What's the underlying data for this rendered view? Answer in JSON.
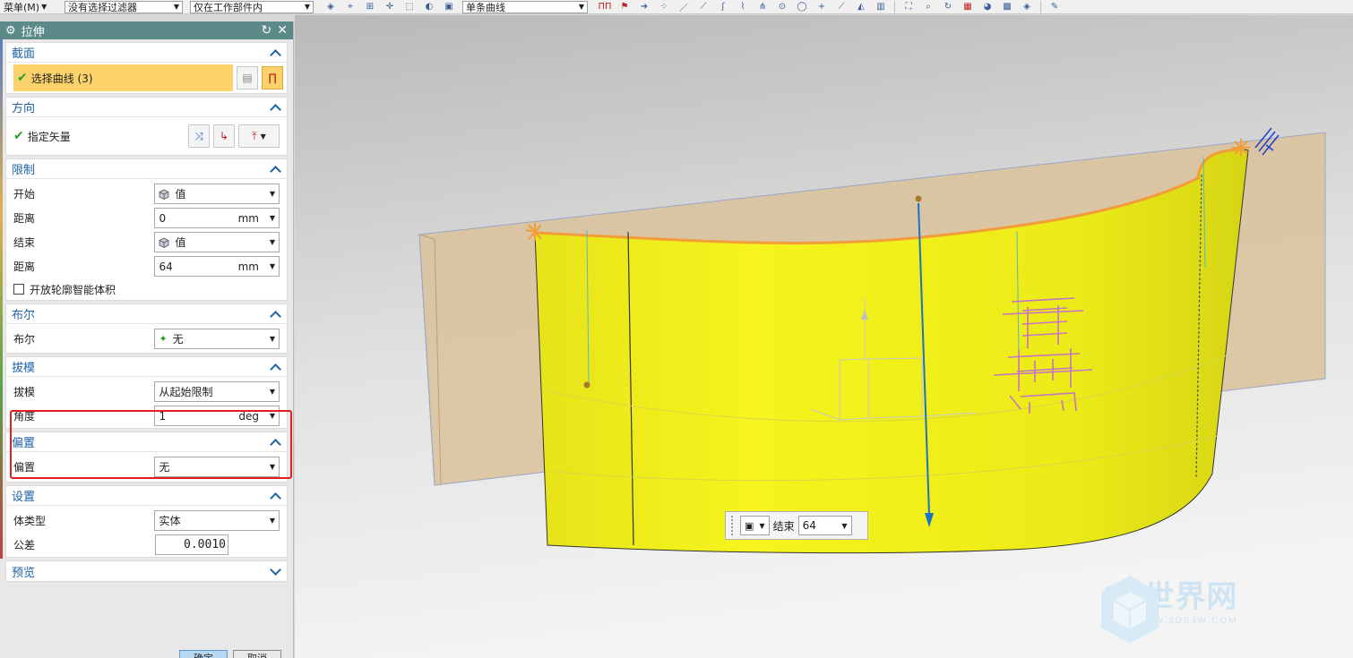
{
  "toolbar": {
    "menu_label": "菜单(M)",
    "filter_select": "没有选择过滤器",
    "scope_select": "仅在工作部件内",
    "curve_rule_select": "单条曲线"
  },
  "dialog": {
    "title": "拉伸",
    "section": {
      "title": "截面",
      "select_curve": "选择曲线 (3)"
    },
    "direction": {
      "title": "方向",
      "specify_vector": "指定矢量"
    },
    "limits": {
      "title": "限制",
      "start_label": "开始",
      "start_value": "值",
      "distance1_label": "距离",
      "distance1_value": "0",
      "distance1_unit": "mm",
      "end_label": "结束",
      "end_value": "值",
      "distance2_label": "距离",
      "distance2_value": "64",
      "distance2_unit": "mm",
      "open_profile_label": "开放轮廓智能体积"
    },
    "boolean": {
      "title": "布尔",
      "label": "布尔",
      "value": "无"
    },
    "draft": {
      "title": "拔模",
      "label": "拔模",
      "value": "从起始限制",
      "angle_label": "角度",
      "angle_value": "1",
      "angle_unit": "deg"
    },
    "offset": {
      "title": "偏置",
      "label": "偏置",
      "value": "无"
    },
    "settings": {
      "title": "设置",
      "body_type_label": "体类型",
      "body_type_value": "实体",
      "tolerance_label": "公差",
      "tolerance_value": "0.0010"
    },
    "preview": {
      "title": "预览"
    },
    "ok_label": "确定",
    "cancel_label": "取消"
  },
  "viewport": {
    "mini_toolbar": {
      "end_label": "结束",
      "end_value": "64"
    },
    "watermark": {
      "brand": "3D世界网",
      "url": "WWW.3DSJW.COM"
    }
  },
  "colors": {
    "extrude_face": "#f2f019",
    "base_block": "#d9c19a",
    "direction_arrow": "#1a73c8",
    "dialog_title_bg": "#5c8a88",
    "highlight": "#fcd36b",
    "annotation_box": "#e02020"
  }
}
